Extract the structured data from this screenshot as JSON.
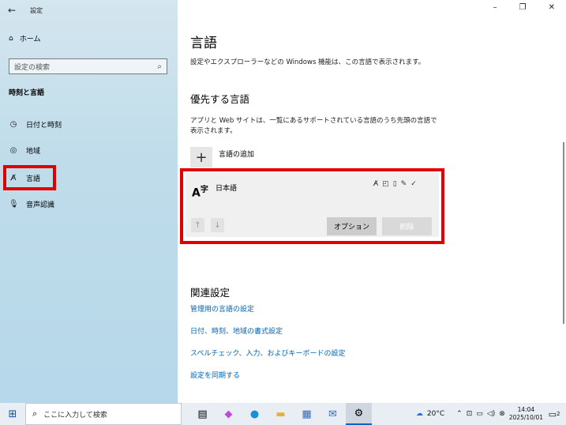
{
  "window": {
    "title": "設定",
    "controls": [
      "–",
      "❐",
      "✕"
    ]
  },
  "sidebar": {
    "home": "ホーム",
    "search_placeholder": "設定の検索",
    "section": "時刻と言語",
    "items": [
      {
        "label": "日付と時刻",
        "icon": "calendar-clock-icon"
      },
      {
        "label": "地域",
        "icon": "globe-icon"
      },
      {
        "label": "言語",
        "icon": "language-icon",
        "selected": true
      },
      {
        "label": "音声認識",
        "icon": "microphone-icon"
      }
    ]
  },
  "main": {
    "title": "言語",
    "description": "設定やエクスプローラーなどの Windows 機能は、この言語で表示されます。",
    "preferred_heading": "優先する言語",
    "preferred_description": "アプリと Web サイトは、一覧にあるサポートされている言語のうち先頭の言語で表示されます。",
    "add_language": "言語の追加",
    "language": {
      "name": "日本語",
      "glyph_base": "A",
      "glyph_sup": "字"
    },
    "options_button": "オプション",
    "remove_button": "削除",
    "related_heading": "関連設定",
    "links": [
      "管理用の言語の設定",
      "日付、時刻、地域の書式設定",
      "スペルチェック、入力、およびキーボードの設定",
      "設定を同期する"
    ]
  },
  "taskbar": {
    "search_placeholder": "ここに入力して検索",
    "weather": "20°C",
    "time": "14:04",
    "date": "2025/10/01",
    "notifications": "2"
  }
}
